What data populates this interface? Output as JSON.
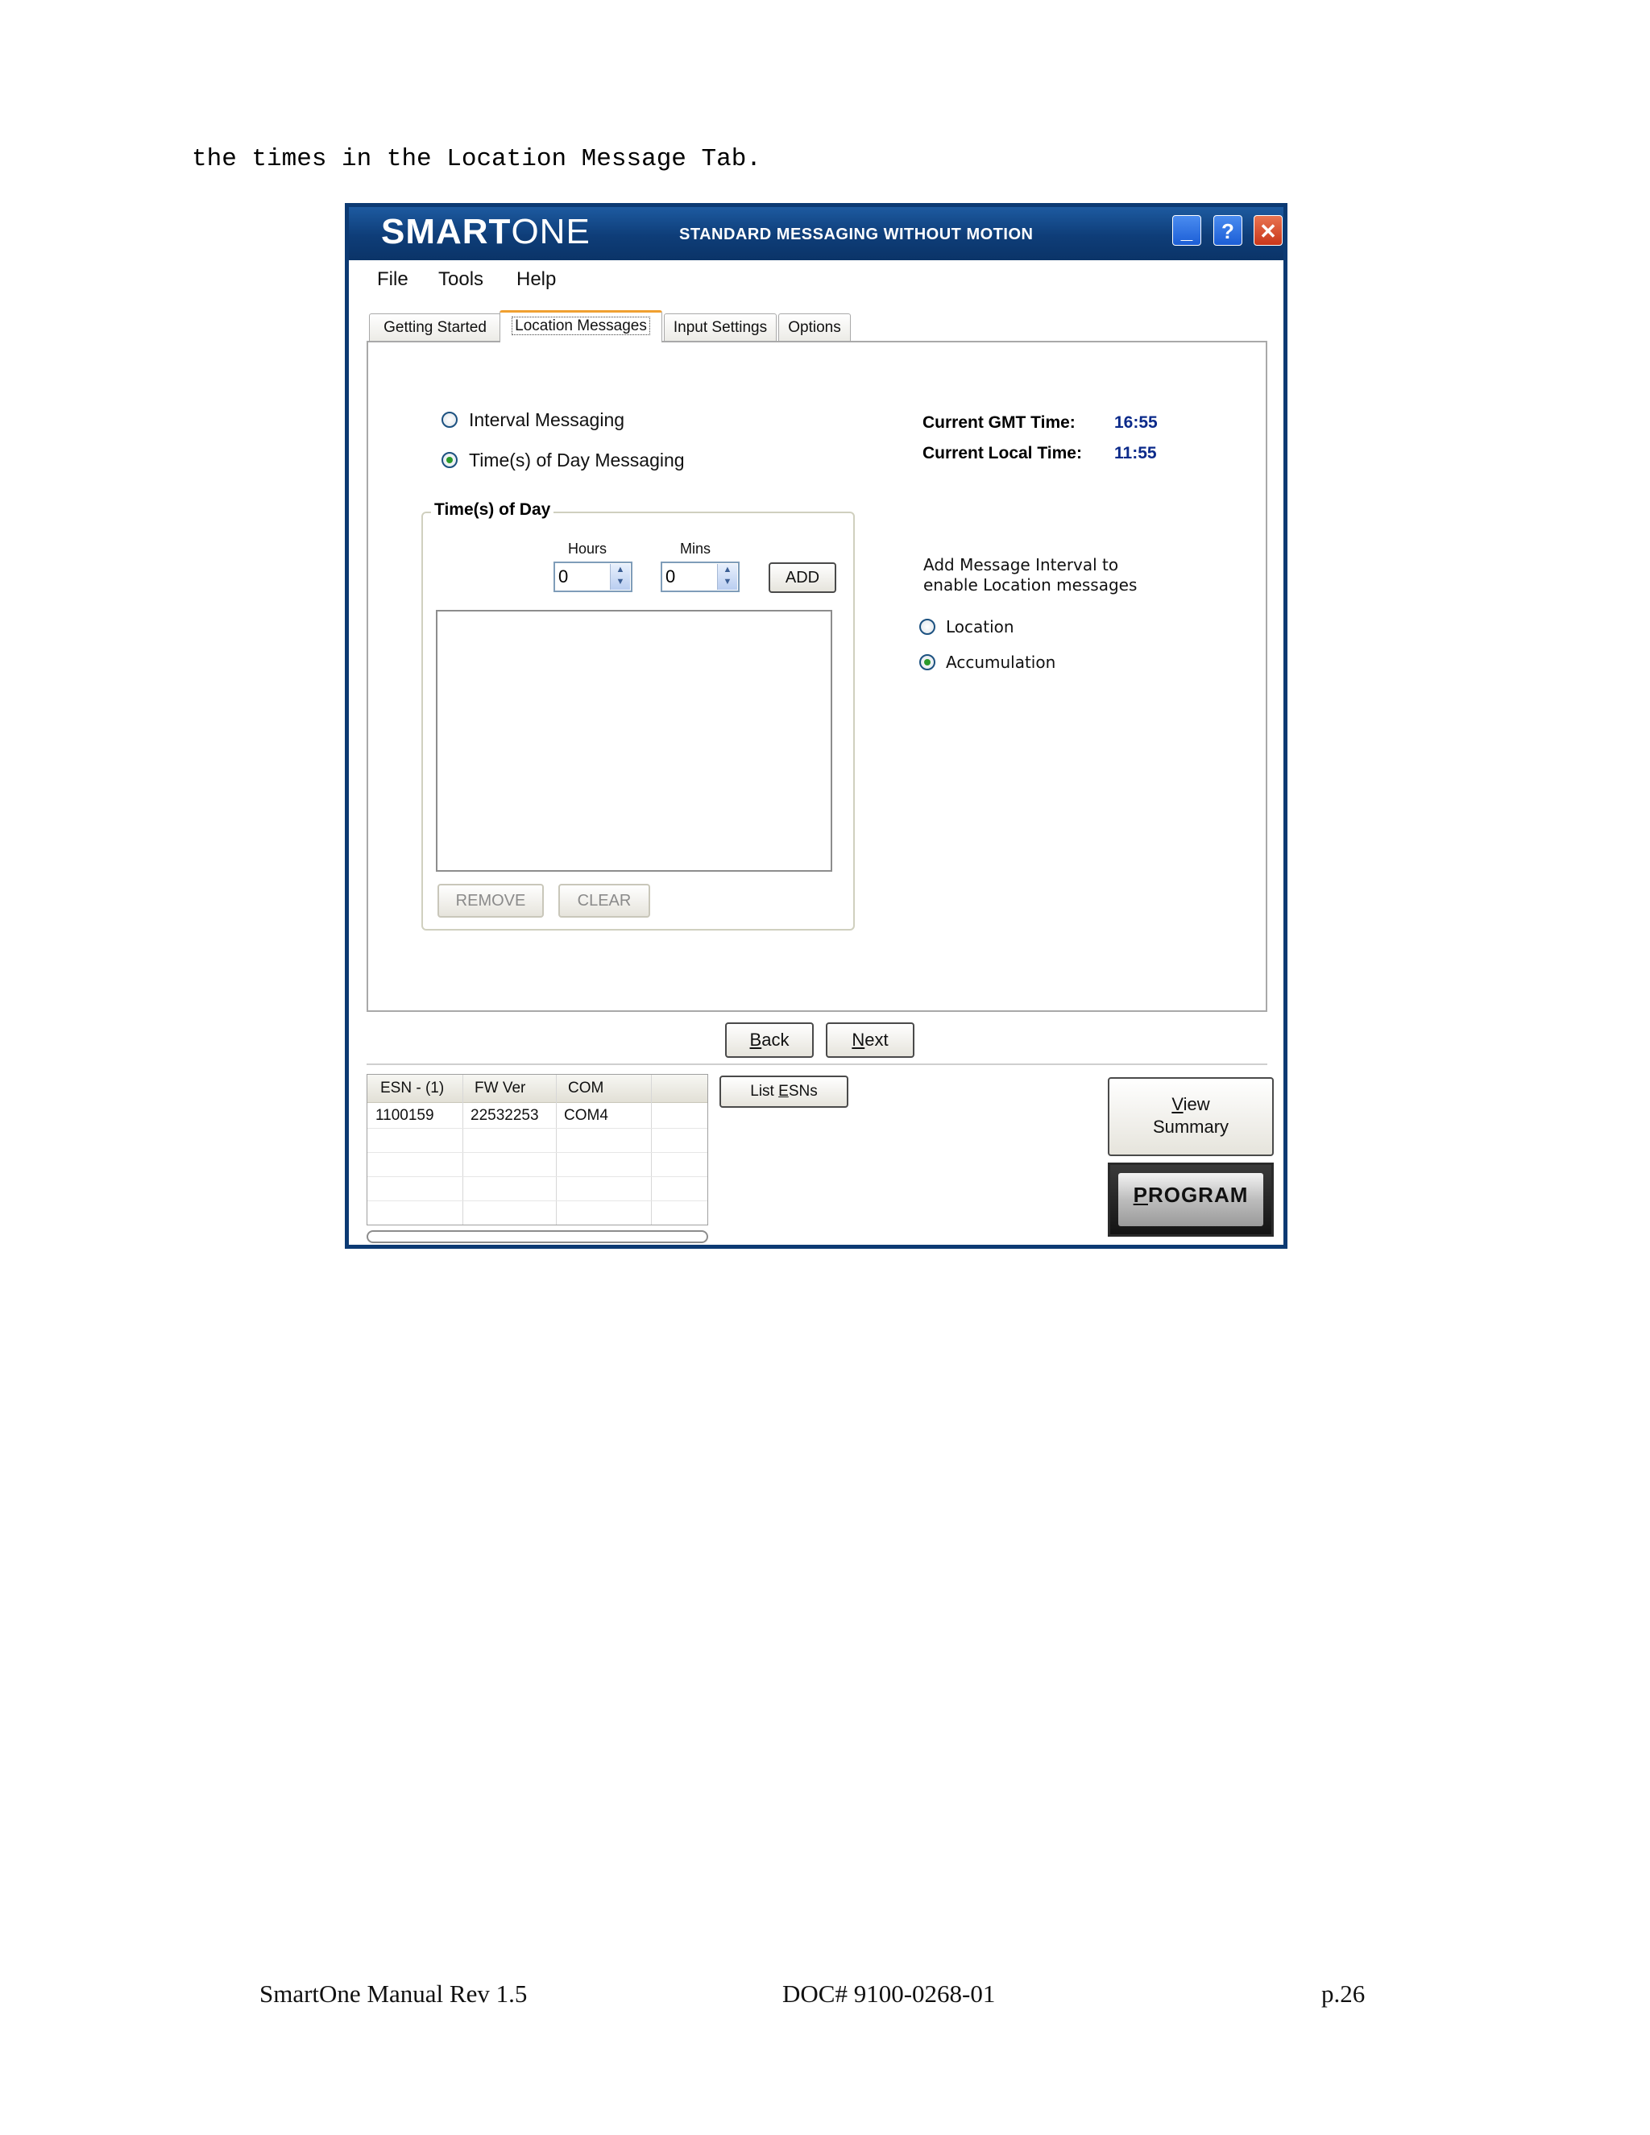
{
  "intro_text": "the times in the Location Message Tab.",
  "window": {
    "brand": {
      "bold": "SMART",
      "light": "ONE"
    },
    "subtitle": "STANDARD MESSAGING WITHOUT MOTION",
    "buttons": {
      "minimize": "_",
      "help": "?",
      "close": "✕"
    }
  },
  "menu": [
    "File",
    "Tools",
    "Help"
  ],
  "tabs": [
    "Getting Started",
    "Location Messages",
    "Input Settings",
    "Options"
  ],
  "active_tab": "Location Messages",
  "messaging_mode": {
    "options": [
      "Interval Messaging",
      "Time(s) of Day Messaging"
    ],
    "selected": "Time(s) of Day Messaging"
  },
  "times": {
    "gmt_label": "Current GMT Time:",
    "gmt_value": "16:55",
    "local_label": "Current Local Time:",
    "local_value": "11:55"
  },
  "times_of_day": {
    "title": "Time(s) of Day",
    "hours_label": "Hours",
    "mins_label": "Mins",
    "hours_value": "0",
    "mins_value": "0",
    "add_label": "ADD",
    "remove_label": "REMOVE",
    "clear_label": "CLEAR"
  },
  "message_type": {
    "note_line1": "Add Message Interval to",
    "note_line2": "enable Location messages",
    "options": [
      "Location",
      "Accumulation"
    ],
    "selected": "Accumulation"
  },
  "nav": {
    "back_access": "B",
    "back_rest": "ack",
    "next_access": "N",
    "next_rest": "ext"
  },
  "esn_table": {
    "columns": [
      "ESN - (1)",
      "FW Ver",
      "COM"
    ],
    "rows": [
      [
        "1100159",
        "22532253",
        "COM4"
      ]
    ]
  },
  "list_esns": {
    "prefix": "List ",
    "access": "E",
    "rest": "SNs"
  },
  "view_summary": {
    "access": "V",
    "rest": "iew",
    "line2": "Summary"
  },
  "program": {
    "access": "P",
    "rest": "ROGRAM"
  },
  "footer": {
    "left": "SmartOne Manual Rev 1.5",
    "center": "DOC# 9100-0268-01",
    "right": "p.26"
  }
}
